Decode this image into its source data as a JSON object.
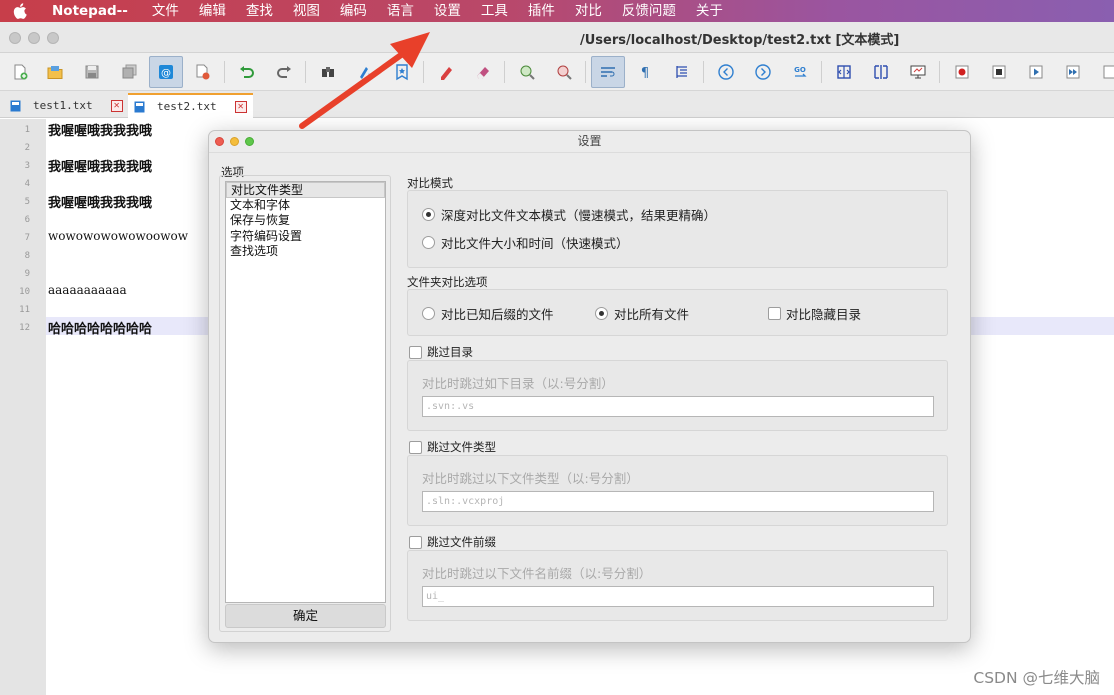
{
  "menubar": {
    "app_name": "Notepad--",
    "items": [
      "文件",
      "编辑",
      "查找",
      "视图",
      "编码",
      "语言",
      "设置",
      "工具",
      "插件",
      "对比",
      "反馈问题",
      "关于"
    ]
  },
  "window": {
    "title": "/Users/localhost/Desktop/test2.txt [文本模式]"
  },
  "toolbar": {
    "icons": [
      "new-file-icon",
      "open-folder-icon",
      "save-icon",
      "save-all-icon",
      "settings-at-icon",
      "close-file-icon",
      "undo-icon",
      "redo-icon",
      "find-icon",
      "replace-icon",
      "bookmark-icon",
      "marker-icon",
      "eraser-icon",
      "zoom-in-icon",
      "zoom-out-icon",
      "word-wrap-icon",
      "show-symbols-icon",
      "indent-guide-icon",
      "previous-icon",
      "next-icon",
      "goto-icon",
      "compare-icon",
      "split-view-icon",
      "monitor-icon",
      "record-icon",
      "stop-icon",
      "play-icon",
      "fast-forward-icon",
      "more-icon"
    ]
  },
  "tabs": [
    {
      "label": "test1.txt",
      "active": false
    },
    {
      "label": "test2.txt",
      "active": true
    }
  ],
  "editor": {
    "line_numbers": [
      "1",
      "2",
      "3",
      "4",
      "5",
      "6",
      "7",
      "8",
      "9",
      "10",
      "11",
      "12"
    ],
    "lines": [
      "我喔喔哦我我我哦",
      "",
      "我喔喔哦我我我哦",
      "",
      "我喔喔哦我我我哦",
      "",
      "wowowowowowoowow",
      "",
      "",
      "aaaaaaaaaaa",
      "",
      "哈哈哈哈哈哈哈哈"
    ],
    "current_line": 12
  },
  "dialog": {
    "title": "设置",
    "options_label": "选项",
    "options": [
      "对比文件类型",
      "文本和字体",
      "保存与恢复",
      "字符编码设置",
      "查找选项"
    ],
    "selected_option": "对比文件类型",
    "ok_button": "确定",
    "compare_mode": {
      "label": "对比模式",
      "options": [
        "深度对比文件文本模式（慢速模式，结果更精确）",
        "对比文件大小和时间（快速模式）"
      ],
      "selected": 0
    },
    "folder_options": {
      "label": "文件夹对比选项",
      "options": [
        "对比已知后缀的文件",
        "对比所有文件"
      ],
      "selected": 1,
      "hidden_dirs_label": "对比隐藏目录",
      "hidden_dirs_checked": false
    },
    "skip_dirs": {
      "label": "跳过目录",
      "checked": false,
      "hint": "对比时跳过如下目录（以:号分割）",
      "placeholder": ".svn:.vs"
    },
    "skip_file_types": {
      "label": "跳过文件类型",
      "checked": false,
      "hint": "对比时跳过以下文件类型（以:号分割）",
      "placeholder": ".sln:.vcxproj"
    },
    "skip_prefix": {
      "label": "跳过文件前缀",
      "checked": false,
      "hint": "对比时跳过以下文件名前缀（以:号分割）",
      "placeholder": "ui_"
    }
  },
  "watermark": "CSDN @七维大脑",
  "colors": {
    "menubar_start": "#c73e4a",
    "menubar_end": "#8a5fb0",
    "arrow": "#e8402a",
    "current_line": "#e8e8fa"
  }
}
